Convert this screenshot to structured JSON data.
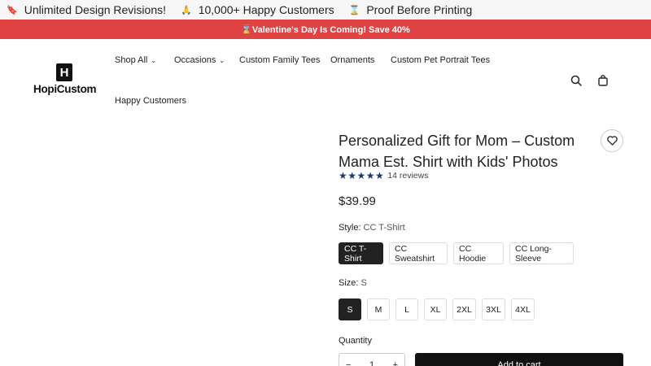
{
  "top_strip": {
    "perks": [
      {
        "icon": "badge-icon",
        "label": "Unlimited Design Revisions!"
      },
      {
        "icon": "praying-hands-icon",
        "label": "10,000+ Happy Customers"
      },
      {
        "icon": "hourglass-icon",
        "label": "Proof Before Printing"
      }
    ]
  },
  "promo": {
    "text": "⌛Valentine's Day Is Coming! Save 40%"
  },
  "header": {
    "logo_text": "HopiCustom",
    "logo_mark": "H",
    "nav": [
      {
        "label": "Shop All",
        "has_dropdown": true
      },
      {
        "label": "Occasions",
        "has_dropdown": true
      },
      {
        "label": "Custom Family Tees",
        "has_dropdown": false
      },
      {
        "label": "Ornaments",
        "has_dropdown": false
      },
      {
        "label": "Custom Pet Portrait Tees",
        "has_dropdown": false
      },
      {
        "label": "Happy Customers",
        "has_dropdown": false
      }
    ]
  },
  "product": {
    "title": "Personalized Gift for Mom – Custom Mama Est. Shirt with Kids' Photos",
    "stars": "★★★★★",
    "rating": 5,
    "reviews": "14 reviews",
    "price": "$39.99",
    "style": {
      "label": "Style:",
      "selected": "CC T-Shirt",
      "options": [
        "CC T-Shirt",
        "CC Sweatshirt",
        "CC Hoodie",
        "CC Long-Sleeve"
      ]
    },
    "size": {
      "label": "Size:",
      "selected": "S",
      "options": [
        "S",
        "M",
        "L",
        "XL",
        "2XL",
        "3XL",
        "4XL"
      ]
    },
    "quantity": {
      "label": "Quantity",
      "value": "1",
      "minus": "−",
      "plus": "+"
    },
    "add_to_cart": "Add to cart"
  },
  "colors": {
    "promo_bg": "#e04344",
    "star": "#1b3b6f",
    "selected_bg": "#222222"
  }
}
